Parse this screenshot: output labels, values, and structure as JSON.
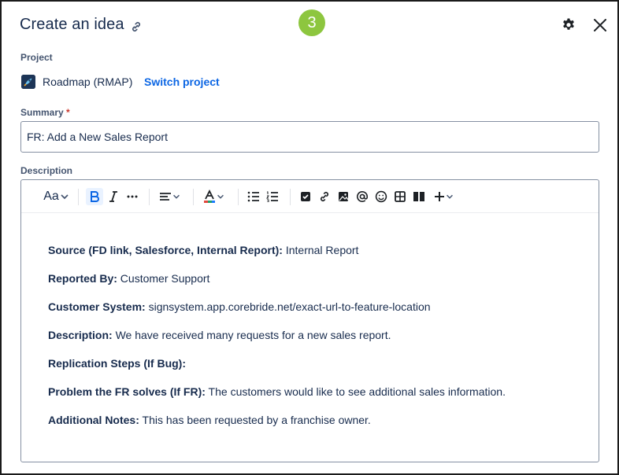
{
  "dialog": {
    "title": "Create an idea",
    "step_number": "3",
    "step_color": "#8dc63f"
  },
  "project": {
    "label": "Project",
    "name": "Roadmap (RMAP)",
    "switch_label": "Switch project",
    "icon": "rocket-icon"
  },
  "summary": {
    "label": "Summary",
    "required_marker": "*",
    "value": "FR: Add a New Sales Report"
  },
  "description": {
    "label": "Description",
    "toolbar": {
      "text_style": "Aa",
      "items": [
        "text-style",
        "bold",
        "italic",
        "more-formatting",
        "alignment",
        "text-color",
        "bullet-list",
        "numbered-list",
        "action-item",
        "link",
        "image",
        "mention",
        "emoji",
        "table",
        "layouts",
        "insert-more"
      ]
    },
    "lines": [
      {
        "label": "Source (FD link, Salesforce, Internal Report):",
        "value": " Internal Report"
      },
      {
        "label": "Reported By:",
        "value": " Customer Support"
      },
      {
        "label": "Customer System:",
        "value": " signsystem.app.corebride.net/exact-url-to-feature-location"
      },
      {
        "label": "Description:",
        "value": " We have received many requests for a new sales report."
      },
      {
        "label": "Replication Steps (If Bug):",
        "value": ""
      },
      {
        "label": "Problem the FR solves (If FR):",
        "value": " The customers would like to see additional sales information."
      },
      {
        "label": "Additional Notes:",
        "value": " This has been requested by a franchise owner."
      }
    ]
  },
  "colors": {
    "link": "#0c66e4",
    "text": "#172b4d",
    "required": "#c9372c"
  }
}
